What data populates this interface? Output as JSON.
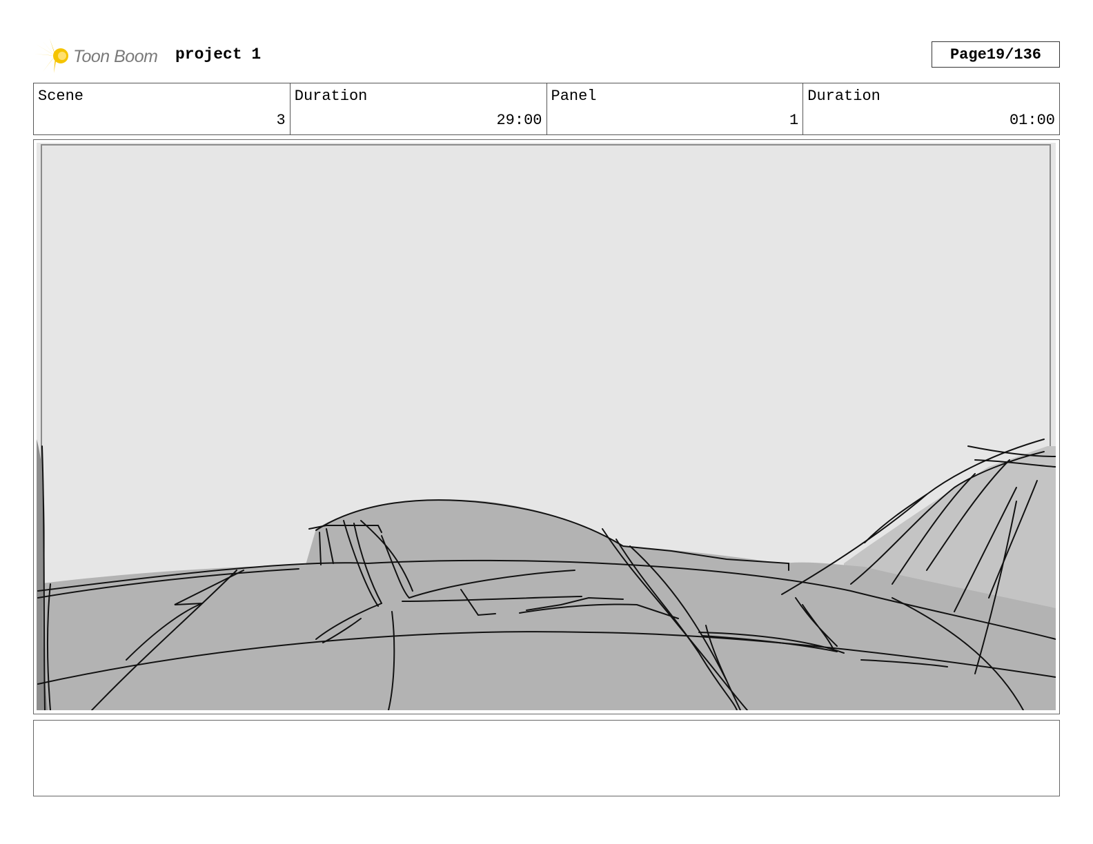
{
  "header": {
    "logo_text": "Toon Boom",
    "project_title": "project 1",
    "page_label": "Page",
    "page_value": "19/136"
  },
  "info": [
    {
      "label": "Scene",
      "value": "3"
    },
    {
      "label": "Duration",
      "value": "29:00"
    },
    {
      "label": "Panel",
      "value": "1"
    },
    {
      "label": "Duration",
      "value": "01:00"
    }
  ],
  "panel": {
    "sky_color": "#e6e6e6",
    "ground_color": "#b3b3b3",
    "hill_color": "#c4c4c4"
  },
  "caption": {
    "text": ""
  },
  "colors": {
    "logo_yellow": "#f5c400",
    "border": "#555555"
  }
}
